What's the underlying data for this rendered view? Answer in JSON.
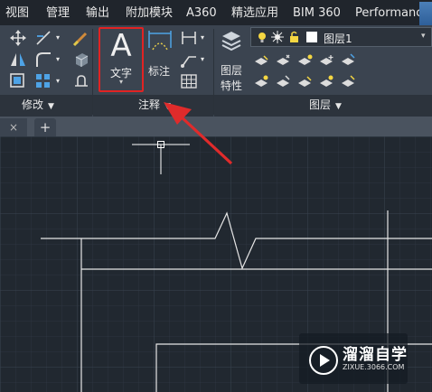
{
  "menu": {
    "items": [
      "视图",
      "管理",
      "输出",
      "附加模块",
      "A360",
      "精选应用",
      "BIM 360",
      "Performance"
    ]
  },
  "ribbon": {
    "panels": {
      "modify": "修改",
      "annotation": "注释",
      "layers": "图层"
    },
    "text_button": {
      "glyph": "A",
      "label": "文字"
    },
    "dimension_label": "标注",
    "layer_properties_label": "图层\n特性",
    "layer_current": "图层1"
  },
  "tabs": {
    "close_glyph": "×",
    "add_glyph": "+"
  },
  "watermark": {
    "title": "溜溜自学",
    "url": "ZIXUE.3066.COM"
  },
  "colors": {
    "ribbon": "#3b4450",
    "canvas": "#212830",
    "highlight_box": "#e12323",
    "arrow": "#e02b2b",
    "lines": "#e6e6e6"
  }
}
